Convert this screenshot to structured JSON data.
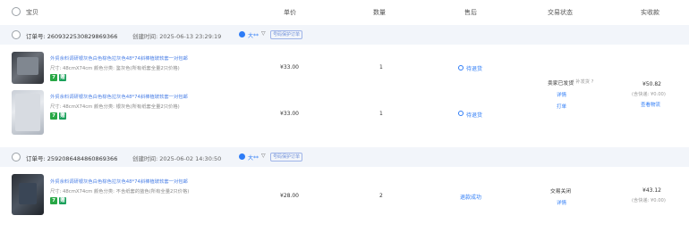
{
  "header": {
    "baby": "宝贝",
    "unit_price": "单价",
    "qty": "数量",
    "after_sale": "售后",
    "trade_status": "交易状态",
    "paid": "实收款"
  },
  "orders": [
    {
      "order_no": "订单号: 2609322530829869366",
      "created": "创建时间: 2025-06-13 23:29:19",
      "shop": "大**",
      "protect": "号码保护订单",
      "items": [
        {
          "title": "外贸余料调研银灰色白色棕色拉灰色48*74斜棒植玻软套一对包邮",
          "spec": "尺寸: 48cmX74cm  颜色分类: 鉴灰色(所有纸套全量2只价格)",
          "price": "¥33.00",
          "qty": "1",
          "after": "待退货"
        },
        {
          "title": "外贸余料调研银灰色白色棕色拉灰色48*74斜棒植玻软套一对包邮",
          "spec": "尺寸: 48cmX74cm  颜色分类: 银灰色(所有纸套全量2只价格)",
          "price": "¥33.00",
          "qty": "1",
          "after": "待退货"
        }
      ],
      "status": "卖家已发货",
      "status_extra": "| 补发货 ?",
      "status_links": [
        "详情",
        "打单"
      ],
      "total": "¥50.82",
      "shipping": "(含快递: ¥0.00)",
      "logistics": "查看物流"
    },
    {
      "order_no": "订单号: 2592086484860869366",
      "created": "创建时间: 2025-06-02 14:30:50",
      "shop": "大**",
      "protect": "号码保护订单",
      "items": [
        {
          "title": "外贸余料调研银灰色白色棕色拉灰色48*74斜棒植玻软套一对包邮",
          "spec": "尺寸: 48cmX74cm  颜色分类: 不含纸套的蓝色(所有全量2只价格)",
          "price": "¥28.00",
          "qty": "2",
          "after": "退款成功"
        }
      ],
      "status": "交易关闭",
      "status_links": [
        "详情"
      ],
      "total": "¥43.12",
      "shipping": "(含快递: ¥0.00)"
    }
  ],
  "badges": {
    "a": "7",
    "b": "赠"
  },
  "colors": {
    "link": "#2e7cf6",
    "band": "#f2f5fa"
  }
}
